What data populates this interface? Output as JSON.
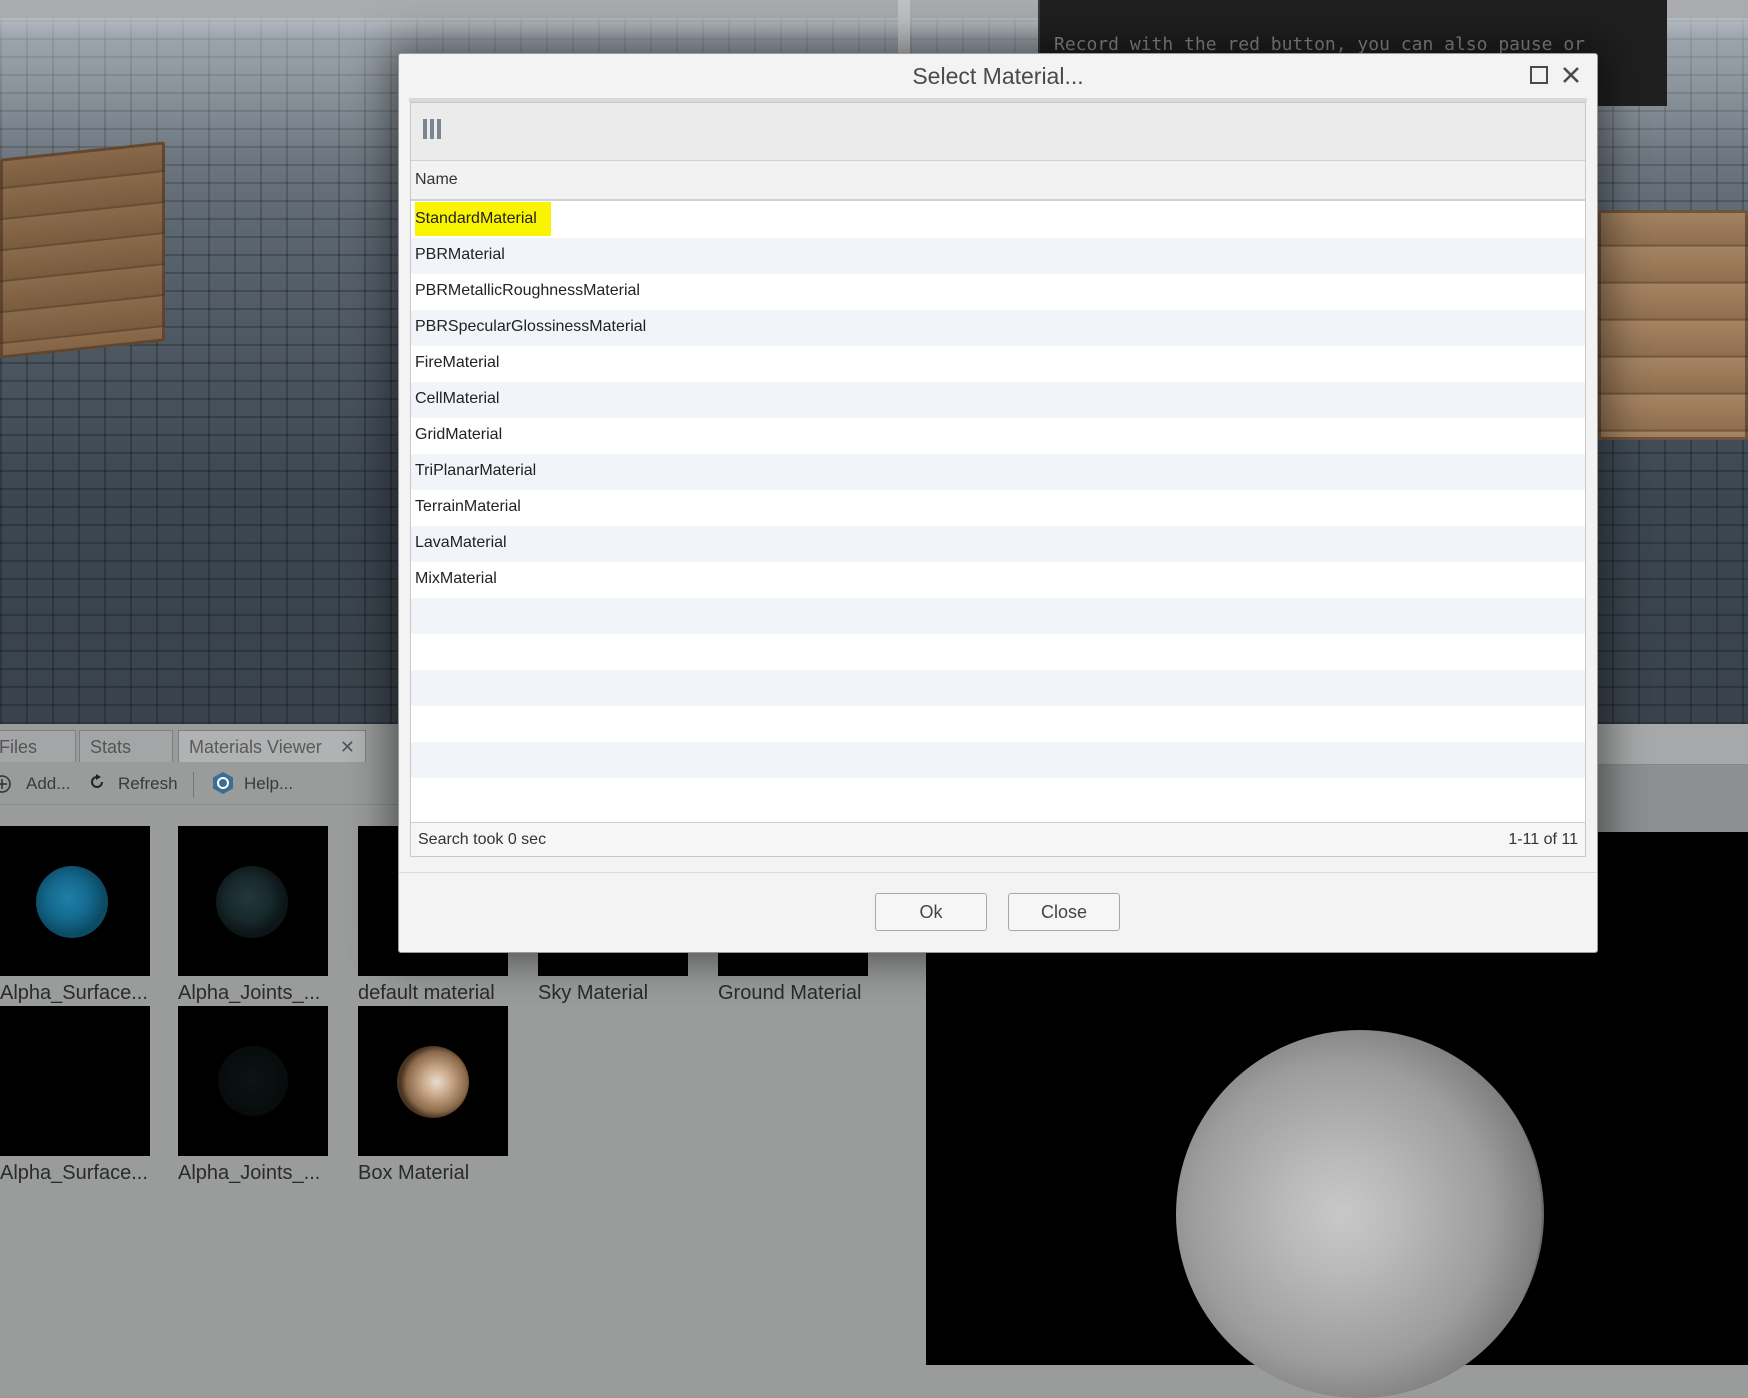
{
  "background": {
    "console_text": "Record with the red button, you can also pause or"
  },
  "panel": {
    "tabs": [
      {
        "label": "Files"
      },
      {
        "label": "Stats"
      },
      {
        "label": "Materials Viewer",
        "close": "✕"
      }
    ],
    "toolbar": {
      "add_label": "Add...",
      "refresh_label": "Refresh",
      "help_label": "Help..."
    },
    "thumbnails": [
      {
        "label": "Alpha_Surface..."
      },
      {
        "label": "Alpha_Joints_..."
      },
      {
        "label": "default material"
      },
      {
        "label": "Sky Material"
      },
      {
        "label": "Ground Material"
      },
      {
        "label": "Alpha_Surface..."
      },
      {
        "label": "Alpha_Joints_..."
      },
      {
        "label": "Box Material"
      }
    ]
  },
  "dialog": {
    "title": "Select Material...",
    "column_header": "Name",
    "rows": [
      "StandardMaterial",
      "PBRMaterial",
      "PBRMetallicRoughnessMaterial",
      "PBRSpecularGlossinessMaterial",
      "FireMaterial",
      "CellMaterial",
      "GridMaterial",
      "TriPlanarMaterial",
      "TerrainMaterial",
      "LavaMaterial",
      "MixMaterial"
    ],
    "highlighted_row": "StandardMaterial",
    "footer_left": "Search took 0 sec",
    "footer_right": "1-11 of 11",
    "ok_label": "Ok",
    "close_label": "Close"
  },
  "colors": {
    "highlight": "#fbf400",
    "row_alt": "#f1f5fa"
  },
  "icons": {
    "maximize": "maximize-icon",
    "close": "close-icon",
    "columns": "columns-icon",
    "add": "add-icon",
    "refresh": "refresh-icon",
    "help": "help-icon"
  }
}
